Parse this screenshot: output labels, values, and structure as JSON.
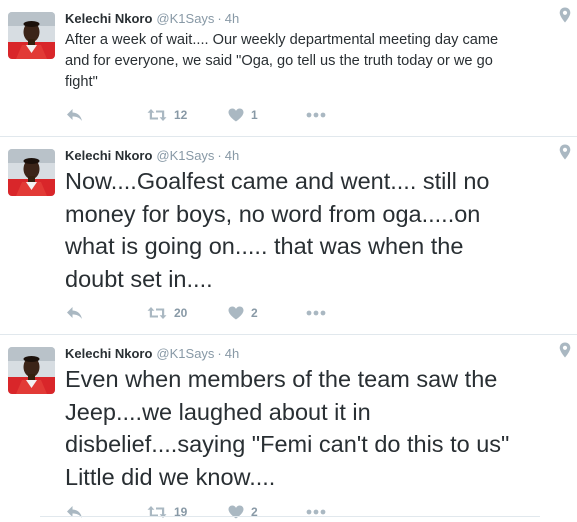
{
  "tweets": [
    {
      "author_name": "Kelechi Nkoro",
      "author_handle": "@K1Says",
      "separator": "·",
      "time": "4h",
      "lines": [
        "After a week of wait.... Our weekly departmental meeting day came",
        "and for everyone, we said \"Oga, go tell us the truth today or we go",
        "fight\""
      ],
      "retweets": "12",
      "likes": "1"
    },
    {
      "author_name": "Kelechi Nkoro",
      "author_handle": "@K1Says",
      "separator": "·",
      "time": "4h",
      "lines": [
        "Now....Goalfest came and went.... still no",
        "money for boys, no word from oga.....on",
        "what is going on..... that was when the",
        "doubt set in...."
      ],
      "retweets": "20",
      "likes": "2"
    },
    {
      "author_name": "Kelechi Nkoro",
      "author_handle": "@K1Says",
      "separator": "·",
      "time": "4h",
      "lines": [
        "Even when members of the team saw the",
        "Jeep....we laughed about it in",
        "disbelief....saying \"Femi can't do this to us\"",
        "Little did we know...."
      ],
      "retweets": "19",
      "likes": "2"
    }
  ],
  "icons": {
    "reply": "reply-icon",
    "retweet": "retweet-icon",
    "like": "heart-icon",
    "more": "more-icon",
    "location": "location-pin-icon"
  },
  "colors": {
    "text": "#292f33",
    "muted": "#8899a6",
    "icon": "#aab8c2",
    "divider": "#e1e8ed"
  }
}
